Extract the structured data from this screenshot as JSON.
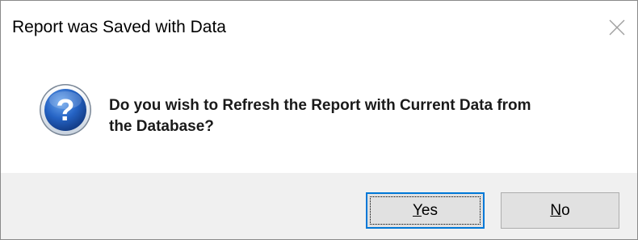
{
  "dialog": {
    "title": "Report was Saved with Data",
    "message_line1": "Do you wish to Refresh the Report with Current Data from",
    "message_line2": "the Database?",
    "icon": "question-icon"
  },
  "buttons": {
    "yes": {
      "mnemonic": "Y",
      "rest": "es"
    },
    "no": {
      "mnemonic": "N",
      "rest": "o"
    }
  },
  "colors": {
    "accent": "#0078d7",
    "footer_bg": "#f0f0f0",
    "button_bg": "#e1e1e1",
    "icon_blue": "#1f5fb5"
  }
}
